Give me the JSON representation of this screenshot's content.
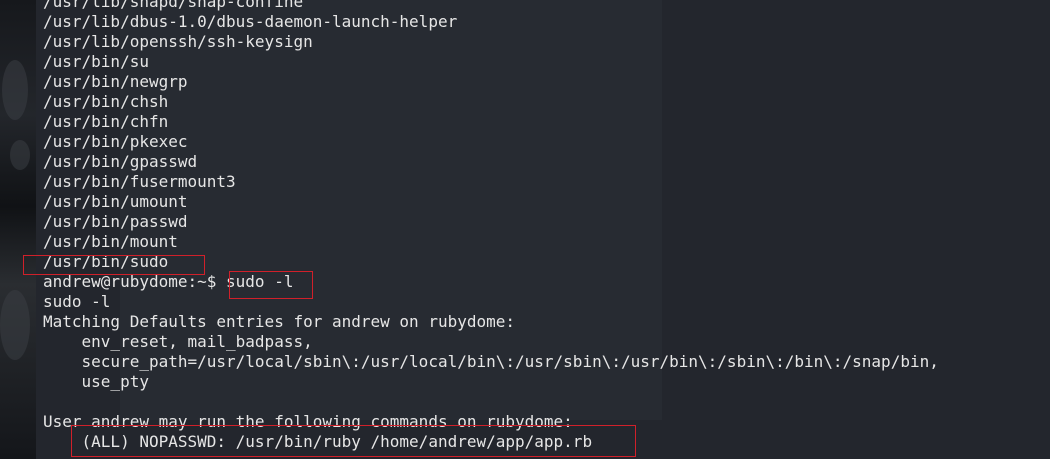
{
  "terminal": {
    "lines": [
      "/usr/lib/snapd/snap-confine",
      "/usr/lib/dbus-1.0/dbus-daemon-launch-helper",
      "/usr/lib/openssh/ssh-keysign",
      "/usr/bin/su",
      "/usr/bin/newgrp",
      "/usr/bin/chsh",
      "/usr/bin/chfn",
      "/usr/bin/pkexec",
      "/usr/bin/gpasswd",
      "/usr/bin/fusermount3",
      "/usr/bin/umount",
      "/usr/bin/passwd",
      "/usr/bin/mount",
      "/usr/bin/sudo",
      "andrew@rubydome:~$ sudo -l",
      "sudo -l",
      "Matching Defaults entries for andrew on rubydome:",
      "    env_reset, mail_badpass,",
      "    secure_path=/usr/local/sbin\\:/usr/local/bin\\:/usr/sbin\\:/usr/bin\\:/sbin\\:/bin\\:/snap/bin,",
      "    use_pty",
      "",
      "User andrew may run the following commands on rubydome:",
      "    (ALL) NOPASSWD: /usr/bin/ruby /home/andrew/app/app.rb"
    ]
  },
  "colors": {
    "terminal_bg": "#23262d",
    "text": "#e6e6e6",
    "highlight": "#d0202a"
  }
}
